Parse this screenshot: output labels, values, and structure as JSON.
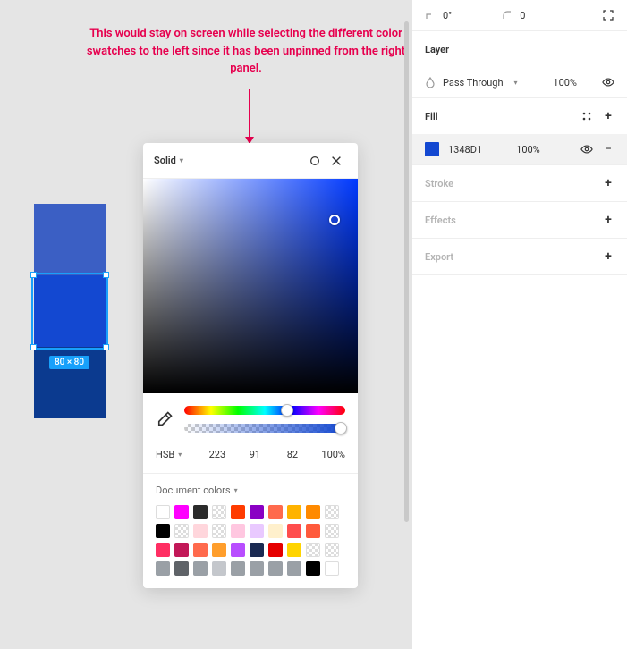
{
  "annotation": "This would stay on screen while selecting the different color swatches to the left since it has been unpinned from the right panel.",
  "canvas": {
    "swatch_colors": [
      "#3b5fc4",
      "#1348d1",
      "#0b3a8f"
    ],
    "selected_index": 1,
    "size_label": "80 × 80"
  },
  "picker": {
    "type_label": "Solid",
    "mode_label": "HSB",
    "values": {
      "h": "223",
      "s": "91",
      "b": "82"
    },
    "opacity": "100%",
    "doc_colors_label": "Document colors",
    "doc_swatches": [
      "#ffffff",
      "#ff00ff",
      "#2b2b2b",
      "checker",
      "#ff3b00",
      "#8a00c4",
      "#ff6a4d",
      "#ffb300",
      "#ff8a00",
      "checker",
      "#000000",
      "checker",
      "#ffd6dc",
      "checker",
      "#ffc7e0",
      "#e9c9ff",
      "#fff0cc",
      "#ff4d4d",
      "#ff5a3c",
      "checker",
      "#ff2e63",
      "#c21858",
      "#ff6a4d",
      "#ff9e2c",
      "#b84dff",
      "#1a2a52",
      "#e60000",
      "#ffd400",
      "checker",
      "checker",
      "#9aa0a6",
      "#5f6368",
      "#9aa0a6",
      "#c4c7cc",
      "#9aa0a6",
      "#9aa0a6",
      "#9aa0a6",
      "#9aa0a6",
      "#000000",
      "#ffffff"
    ]
  },
  "panel": {
    "rotation": "0°",
    "corner": "0",
    "layer_label": "Layer",
    "blend_mode": "Pass Through",
    "layer_opacity": "100%",
    "fill_label": "Fill",
    "fill_hex": "1348D1",
    "fill_opacity": "100%",
    "stroke_label": "Stroke",
    "effects_label": "Effects",
    "export_label": "Export"
  }
}
